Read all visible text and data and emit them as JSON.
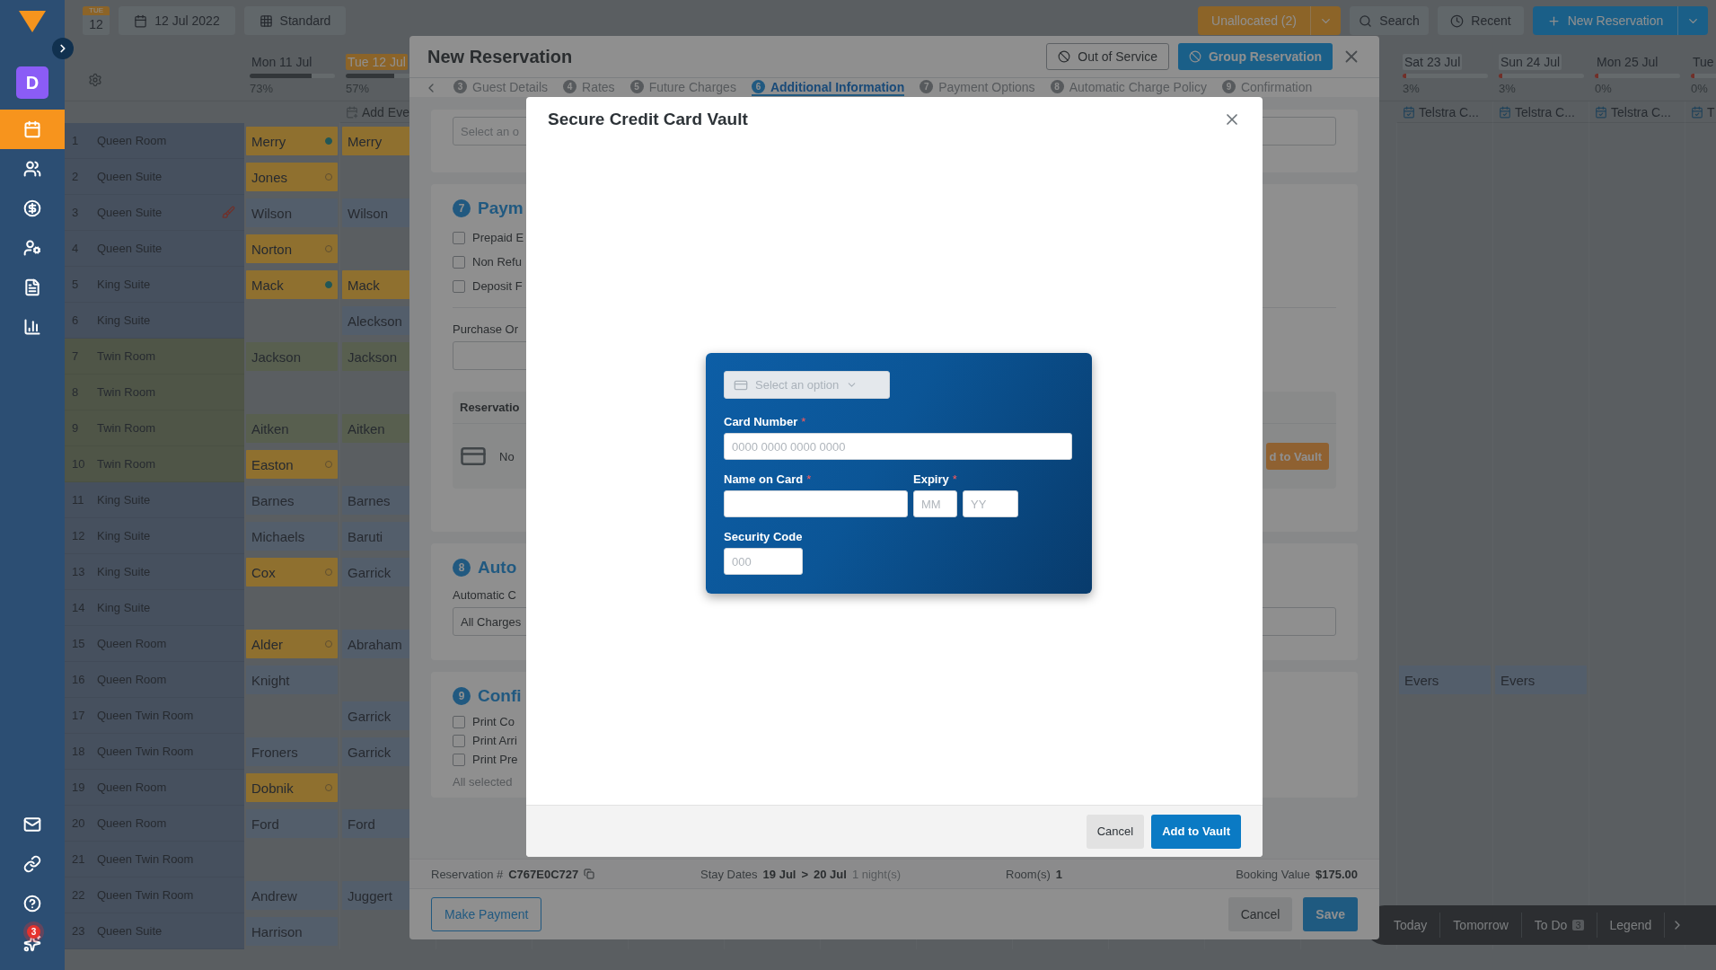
{
  "sidebar": {
    "avatar": "D",
    "items": [
      {
        "kind": "calendar",
        "selected": true
      },
      {
        "kind": "people",
        "selected": false
      },
      {
        "kind": "money",
        "selected": false
      },
      {
        "kind": "user-settings",
        "selected": false
      },
      {
        "kind": "document",
        "selected": false
      },
      {
        "kind": "chart",
        "selected": false
      }
    ],
    "bottom_items": [
      {
        "kind": "mail"
      },
      {
        "kind": "link"
      },
      {
        "kind": "help"
      },
      {
        "kind": "sparkle",
        "badge": "3"
      }
    ]
  },
  "toolbar": {
    "weekday": "TUE",
    "day": "12",
    "date": "12 Jul 2022",
    "view": "Standard",
    "unallocated": "Unallocated (2)",
    "search": "Search",
    "recent": "Recent",
    "new_reservation": "New Reservation"
  },
  "calendar": {
    "columns": [
      {
        "label": "Mon 11 Jul",
        "percent": "73%",
        "level": 0.73,
        "today": false,
        "weekend": false
      },
      {
        "label": "Tue 12 Jul",
        "percent": "57%",
        "level": 0.57,
        "today": true,
        "weekend": false,
        "event": {
          "kind": "add",
          "label": "Add Eve"
        }
      },
      {
        "label": "Sat 23 Jul",
        "percent": "3%",
        "level": 0.03,
        "today": false,
        "weekend": true,
        "event": {
          "kind": "event",
          "label": "Telstra C..."
        }
      },
      {
        "label": "Sun 24 Jul",
        "percent": "3%",
        "level": 0.03,
        "today": false,
        "weekend": true,
        "event": {
          "kind": "event",
          "label": "Telstra C..."
        }
      },
      {
        "label": "Mon 25 Jul",
        "percent": "0%",
        "level": 0,
        "today": false,
        "weekend": false,
        "event": {
          "kind": "event",
          "label": "Telstra C..."
        }
      },
      {
        "label": "Tue",
        "percent": "0%",
        "level": 0,
        "today": false,
        "weekend": false,
        "event": {
          "kind": "event",
          "label": "T"
        }
      }
    ],
    "rows": [
      {
        "number": "1",
        "room": "Queen Room",
        "kind": "plain",
        "dirty": false,
        "mon_11_jul": {
          "guest": "Merry",
          "kind": "arrival",
          "confirmed": true
        },
        "tue_12_jul": {
          "guest": "Merry",
          "kind": "arrival"
        }
      },
      {
        "number": "2",
        "room": "Queen Suite",
        "kind": "plain",
        "dirty": false,
        "mon_11_jul": {
          "guest": "Jones",
          "kind": "arrival",
          "confirmed": false
        }
      },
      {
        "number": "3",
        "room": "Queen Suite",
        "kind": "plain",
        "dirty": true,
        "mon_11_jul": {
          "guest": "Wilson",
          "kind": "stay"
        },
        "tue_12_jul": {
          "guest": "Wilson",
          "kind": "stay"
        }
      },
      {
        "number": "4",
        "room": "Queen Suite",
        "kind": "plain",
        "dirty": false,
        "mon_11_jul": {
          "guest": "Norton",
          "kind": "arrival",
          "confirmed": false
        }
      },
      {
        "number": "5",
        "room": "King Suite",
        "kind": "plain",
        "dirty": false,
        "mon_11_jul": {
          "guest": "Mack",
          "kind": "arrival",
          "confirmed": true
        },
        "tue_12_jul": {
          "guest": "Mack",
          "kind": "arrival"
        }
      },
      {
        "number": "6",
        "room": "King Suite",
        "kind": "plain",
        "dirty": false,
        "tue_12_jul": {
          "guest": "Aleckson",
          "kind": "stay"
        }
      },
      {
        "number": "7",
        "room": "Twin Room",
        "kind": "grouped",
        "dirty": false,
        "mon_11_jul": {
          "guest": "Jackson",
          "kind": "group"
        },
        "tue_12_jul": {
          "guest": "Jackson",
          "kind": "group"
        }
      },
      {
        "number": "8",
        "room": "Twin Room",
        "kind": "grouped",
        "dirty": false
      },
      {
        "number": "9",
        "room": "Twin Room",
        "kind": "grouped",
        "dirty": false,
        "mon_11_jul": {
          "guest": "Aitken",
          "kind": "group"
        },
        "tue_12_jul": {
          "guest": "Aitken",
          "kind": "group"
        }
      },
      {
        "number": "10",
        "room": "Twin Room",
        "kind": "grouped",
        "dirty": false,
        "mon_11_jul": {
          "guest": "Easton",
          "kind": "arrival",
          "confirmed": false
        }
      },
      {
        "number": "11",
        "room": "King Suite",
        "kind": "plain",
        "dirty": false,
        "mon_11_jul": {
          "guest": "Barnes",
          "kind": "stay"
        },
        "tue_12_jul": {
          "guest": "Barnes",
          "kind": "stay"
        }
      },
      {
        "number": "12",
        "room": "King Suite",
        "kind": "plain",
        "dirty": false,
        "mon_11_jul": {
          "guest": "Michaels",
          "kind": "stay"
        },
        "tue_12_jul": {
          "guest": "Baruti",
          "kind": "stay"
        }
      },
      {
        "number": "13",
        "room": "King Suite",
        "kind": "plain",
        "dirty": false,
        "mon_11_jul": {
          "guest": "Cox",
          "kind": "arrival",
          "confirmed": false
        },
        "tue_12_jul": {
          "guest": "Garrick",
          "kind": "stay"
        }
      },
      {
        "number": "14",
        "room": "King Suite",
        "kind": "plain",
        "dirty": false
      },
      {
        "number": "15",
        "room": "Queen Room",
        "kind": "plain",
        "dirty": false,
        "mon_11_jul": {
          "guest": "Alder",
          "kind": "arrival",
          "confirmed": false
        },
        "tue_12_jul": {
          "guest": "Abraham",
          "kind": "stay"
        }
      },
      {
        "number": "16",
        "room": "Queen Room",
        "kind": "plain",
        "dirty": false,
        "mon_11_jul": {
          "guest": "Knight",
          "kind": "stay"
        },
        "sat_23_jul": {
          "guest": "Evers",
          "kind": "stay"
        },
        "sun_24_jul": {
          "guest": "Evers",
          "kind": "stay"
        }
      },
      {
        "number": "17",
        "room": "Queen Twin Room",
        "kind": "plain",
        "dirty": false,
        "tue_12_jul": {
          "guest": "Garrick",
          "kind": "stay"
        }
      },
      {
        "number": "18",
        "room": "Queen Twin Room",
        "kind": "plain",
        "dirty": false,
        "mon_11_jul": {
          "guest": "Froners",
          "kind": "stay"
        },
        "tue_12_jul": {
          "guest": "Garrick",
          "kind": "stay"
        }
      },
      {
        "number": "19",
        "room": "Queen Room",
        "kind": "plain",
        "dirty": false,
        "mon_11_jul": {
          "guest": "Dobnik",
          "kind": "arrival",
          "confirmed": false
        }
      },
      {
        "number": "20",
        "room": "Queen Room",
        "kind": "plain",
        "dirty": false,
        "mon_11_jul": {
          "guest": "Ford",
          "kind": "stay"
        },
        "tue_12_jul": {
          "guest": "Ford",
          "kind": "stay"
        }
      },
      {
        "number": "21",
        "room": "Queen Twin Room",
        "kind": "plain",
        "dirty": false
      },
      {
        "number": "22",
        "room": "Queen Twin Room",
        "kind": "plain",
        "dirty": false,
        "mon_11_jul": {
          "guest": "Andrew",
          "kind": "stay"
        },
        "tue_12_jul": {
          "guest": "Juggert",
          "kind": "stay"
        }
      },
      {
        "number": "23",
        "room": "Queen Suite",
        "kind": "plain",
        "dirty": false,
        "mon_11_jul": {
          "guest": "Harrison",
          "kind": "stay"
        }
      }
    ]
  },
  "quick_bar": {
    "items": [
      {
        "label": "Today"
      },
      {
        "label": "Tomorrow"
      },
      {
        "label": "To Do",
        "count": "3"
      },
      {
        "label": "Legend"
      }
    ]
  },
  "new_reservation": {
    "title": "New Reservation",
    "out_of_service": "Out of Service",
    "group_reservation": "Group Reservation",
    "steps": [
      {
        "number": "3",
        "label": "Guest Details",
        "selected": false
      },
      {
        "number": "4",
        "label": "Rates",
        "selected": false
      },
      {
        "number": "5",
        "label": "Future Charges",
        "selected": false
      },
      {
        "number": "6",
        "label": "Additional Information",
        "selected": true
      },
      {
        "number": "7",
        "label": "Payment Options",
        "selected": false
      },
      {
        "number": "8",
        "label": "Automatic Charge Policy",
        "selected": false
      },
      {
        "number": "9",
        "label": "Confirmation",
        "selected": false
      }
    ],
    "top_field": {
      "placeholder": "Select an o"
    },
    "payment": {
      "number": "7",
      "title": "Paym",
      "options": [
        {
          "label": "Prepaid E",
          "checked": false
        },
        {
          "label": "Non Refu",
          "checked": false
        },
        {
          "label": "Deposit F",
          "checked": false
        }
      ],
      "purchase_order_label": "Purchase Or",
      "card_panel": {
        "title": "Reservatio",
        "status": "No",
        "button": "d to Vault"
      }
    },
    "charge_policy": {
      "number": "8",
      "title": "Auto",
      "label": "Automatic C",
      "value": "All Charges"
    },
    "confirmation": {
      "number": "9",
      "title": "Confi",
      "options": [
        {
          "label": "Print Co",
          "checked": false
        },
        {
          "label": "Print Arri",
          "checked": false
        },
        {
          "label": "Print Pre",
          "checked": false
        }
      ],
      "note": "All selected"
    },
    "summary": {
      "reservation_label": "Reservation #",
      "reservation_number": "C767E0C727",
      "stay_label": "Stay Dates",
      "arrival": "19 Jul",
      "separator": ">",
      "departure": "20 Jul",
      "nights": "1 night(s)",
      "rooms_label": "Room(s)",
      "rooms": "1",
      "value_label": "Booking Value",
      "value": "$175.00"
    },
    "make_payment": "Make Payment",
    "cancel": "Cancel",
    "save": "Save"
  },
  "vault": {
    "title": "Secure Credit Card Vault",
    "card_type": {
      "placeholder": "Select an option",
      "disabled": true
    },
    "card_number": {
      "label": "Card Number",
      "mark": "*",
      "placeholder": "0000 0000 0000 0000"
    },
    "name_on_card": {
      "label": "Name on Card",
      "mark": "*"
    },
    "expiry": {
      "label": "Expiry",
      "mark": "*",
      "month_placeholder": "MM",
      "year_placeholder": "YY"
    },
    "security_code": {
      "label": "Security Code",
      "placeholder": "000"
    },
    "cancel": "Cancel",
    "add": "Add to Vault"
  }
}
